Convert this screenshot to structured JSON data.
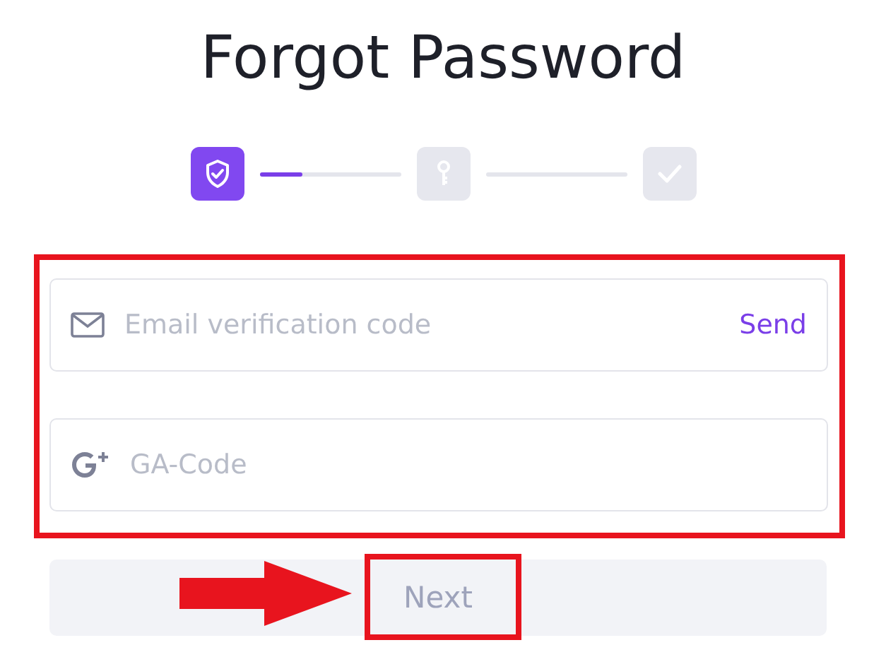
{
  "title": "Forgot Password",
  "steps": [
    {
      "kind": "shield",
      "active": true
    },
    {
      "kind": "key",
      "active": false
    },
    {
      "kind": "check",
      "active": false
    }
  ],
  "connectors": [
    {
      "level": 0.3
    },
    {
      "level": 0
    }
  ],
  "fields": [
    {
      "kind": "email",
      "placeholder": "Email verification code",
      "action": "Send"
    },
    {
      "kind": "google",
      "placeholder": "GA-Code"
    }
  ],
  "next_button": {
    "label": "Next",
    "disabled": true
  },
  "annotations": [
    {
      "kind": "frame"
    },
    {
      "kind": "frame"
    },
    {
      "kind": "arrow"
    }
  ]
}
